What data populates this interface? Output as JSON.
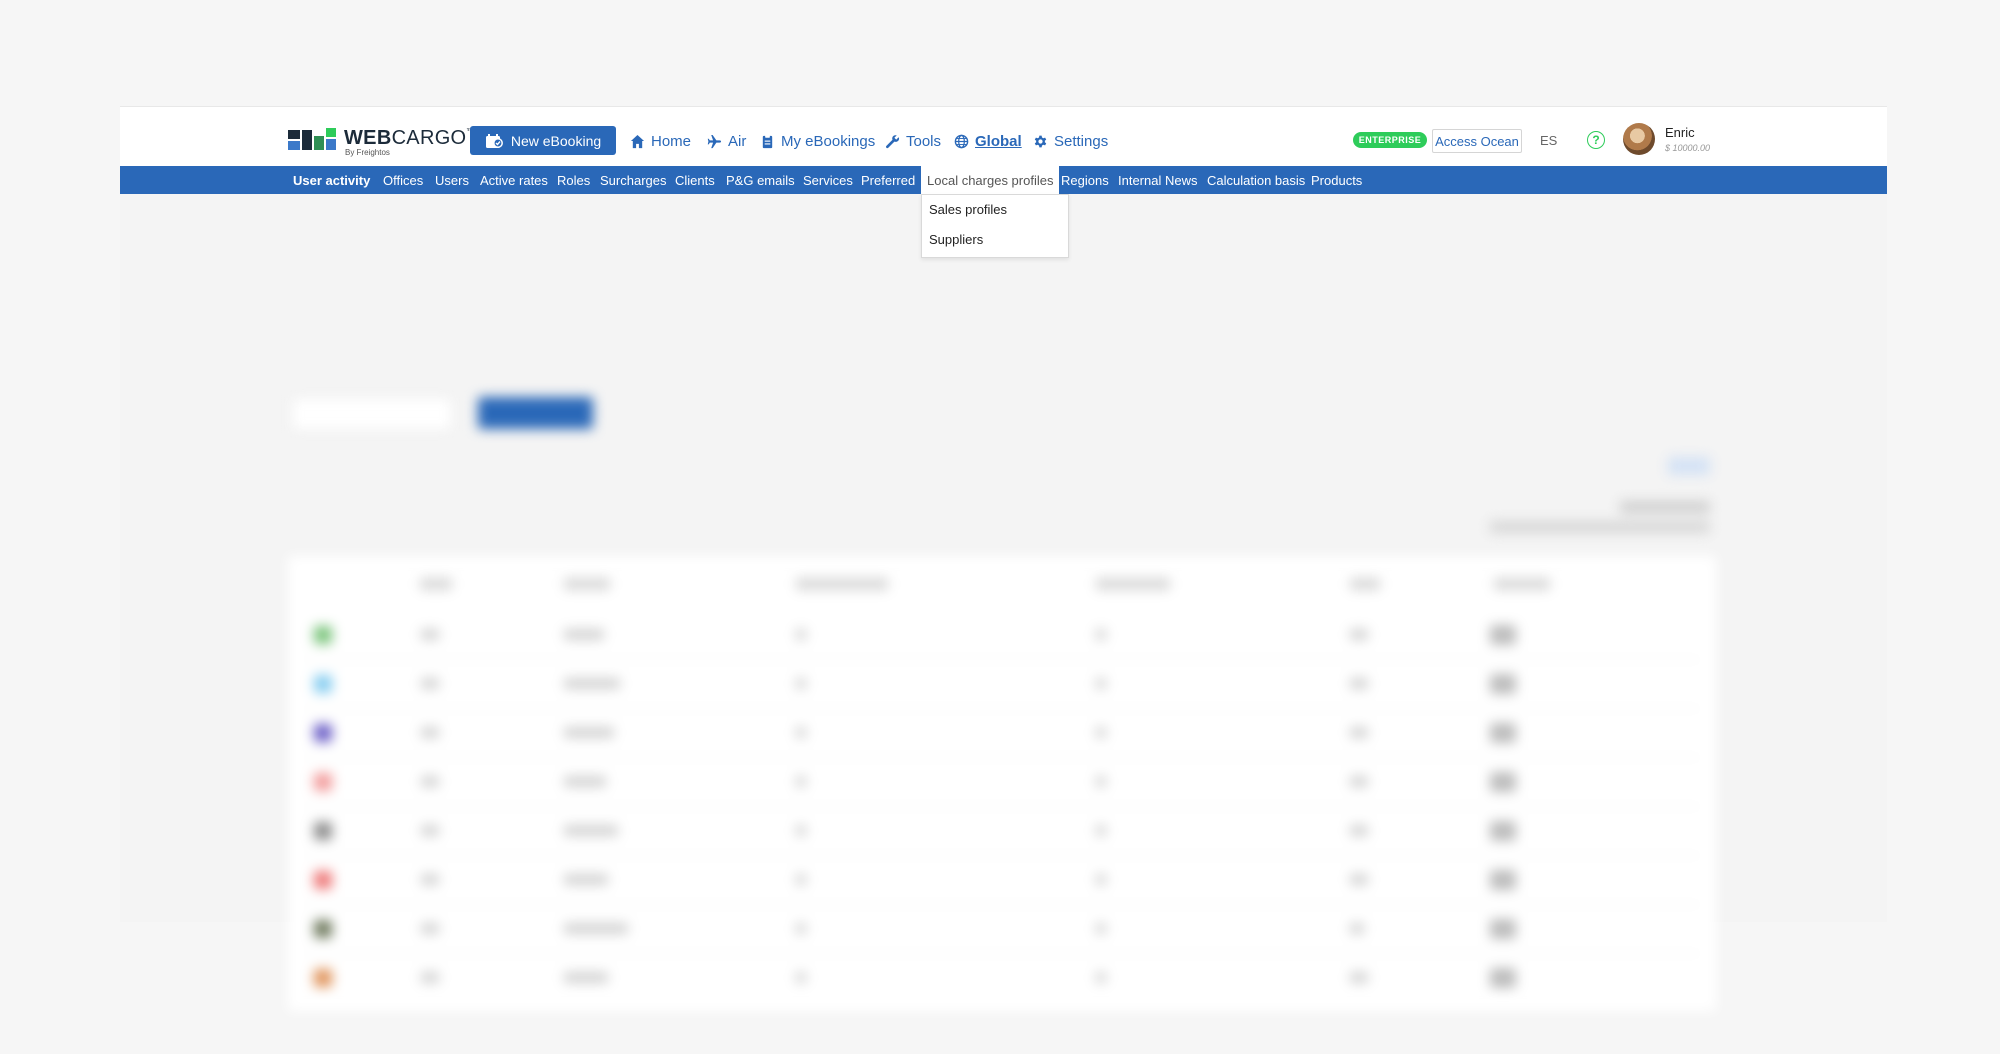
{
  "header": {
    "brand_web": "WEB",
    "brand_cargo": "CARGO",
    "brand_tm": "™",
    "brand_sub": "By Freightos",
    "new_ebooking": "New eBooking",
    "nav": [
      {
        "label": "Home",
        "icon": "home-icon"
      },
      {
        "label": "Air",
        "icon": "plane-icon"
      },
      {
        "label": "My eBookings",
        "icon": "clipboard-icon"
      },
      {
        "label": "Tools",
        "icon": "wrench-icon"
      },
      {
        "label": "Global",
        "icon": "globe-icon",
        "active": true
      },
      {
        "label": "Settings",
        "icon": "gear-icon"
      }
    ],
    "enterprise_badge": "ENTERPRISE",
    "access_ocean": "Access Ocean",
    "language": "ES",
    "help": "?",
    "user": {
      "name": "Enric",
      "balance": "$ 10000.00"
    }
  },
  "subnav": {
    "items": [
      "User activity",
      "Offices",
      "Users",
      "Active rates",
      "Roles",
      "Surcharges",
      "Clients",
      "P&G emails",
      "Services",
      "Preferred",
      "Local charges profiles",
      "Regions",
      "Internal News",
      "Calculation basis",
      "Products"
    ],
    "current": "User activity",
    "open": "Local charges profiles"
  },
  "dropdown": {
    "items": [
      "Sales profiles",
      "Suppliers"
    ]
  },
  "colors": {
    "primary": "#2a68b8",
    "enterprise": "#2ecc5a",
    "background": "#f4f4f4"
  }
}
